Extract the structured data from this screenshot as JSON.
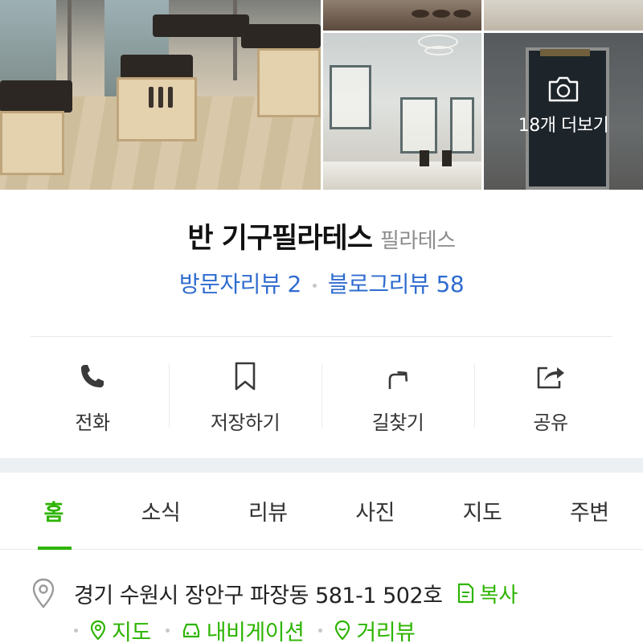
{
  "photos": {
    "more_label": "18개 더보기"
  },
  "place": {
    "name": "반 기구필라테스",
    "category": "필라테스"
  },
  "reviews": {
    "visitor_label": "방문자리뷰 2",
    "blog_label": "블로그리뷰 58"
  },
  "actions": [
    {
      "label": "전화",
      "icon": "phone-icon"
    },
    {
      "label": "저장하기",
      "icon": "bookmark-icon"
    },
    {
      "label": "길찾기",
      "icon": "directions-icon"
    },
    {
      "label": "공유",
      "icon": "share-icon"
    }
  ],
  "tabs": [
    {
      "label": "홈",
      "active": true
    },
    {
      "label": "소식",
      "active": false
    },
    {
      "label": "리뷰",
      "active": false
    },
    {
      "label": "사진",
      "active": false
    },
    {
      "label": "지도",
      "active": false
    },
    {
      "label": "주변",
      "active": false
    }
  ],
  "address": {
    "text": "경기 수원시 장안구 파장동 581-1 502호",
    "copy_label": "복사",
    "links": [
      {
        "label": "지도",
        "icon": "map-pin-icon"
      },
      {
        "label": "내비게이션",
        "icon": "car-icon"
      },
      {
        "label": "거리뷰",
        "icon": "street-view-icon"
      }
    ]
  },
  "colors": {
    "accent_green": "#2db400",
    "link_blue": "#2f6ccf",
    "muted_gray": "#8c8c8c"
  }
}
